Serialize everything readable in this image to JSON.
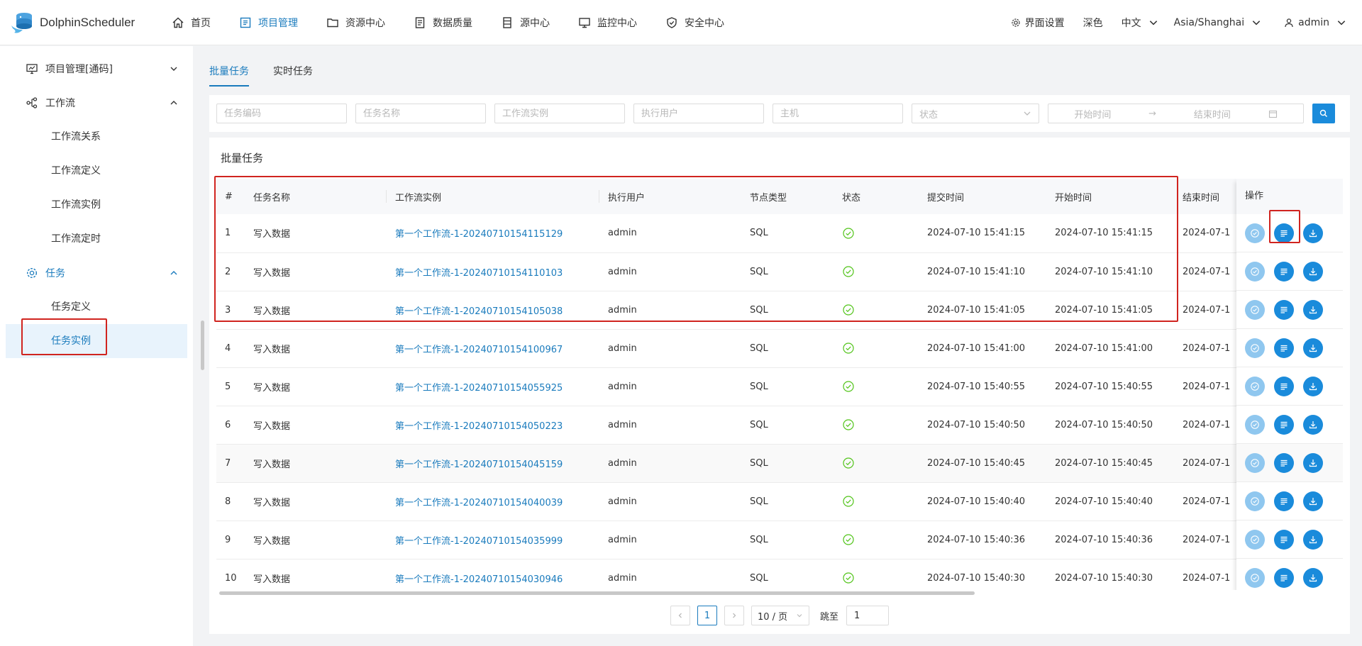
{
  "header": {
    "logo_text": "DolphinScheduler",
    "nav": [
      {
        "label": "首页",
        "icon": "home-icon"
      },
      {
        "label": "项目管理",
        "icon": "project-icon",
        "active": true
      },
      {
        "label": "资源中心",
        "icon": "folder-icon"
      },
      {
        "label": "数据质量",
        "icon": "data-quality-icon"
      },
      {
        "label": "源中心",
        "icon": "datasource-icon"
      },
      {
        "label": "监控中心",
        "icon": "monitor-icon"
      },
      {
        "label": "安全中心",
        "icon": "security-icon"
      }
    ],
    "settings_label": "界面设置",
    "theme_label": "深色",
    "language_label": "中文",
    "timezone_label": "Asia/Shanghai",
    "user_label": "admin"
  },
  "sidebar": {
    "groups": [
      {
        "label": "项目管理[通码]"
      },
      {
        "label": "工作流",
        "items": [
          "工作流关系",
          "工作流定义",
          "工作流实例",
          "工作流定时"
        ]
      },
      {
        "label": "任务",
        "items": [
          "任务定义",
          "任务实例"
        ]
      }
    ]
  },
  "tabs": [
    "批量任务",
    "实时任务"
  ],
  "filter": {
    "task_code_placeholder": "任务编码",
    "task_name_placeholder": "任务名称",
    "workflow_instance_placeholder": "工作流实例",
    "exec_user_placeholder": "执行用户",
    "host_placeholder": "主机",
    "state_placeholder": "状态",
    "start_time_placeholder": "开始时间",
    "end_time_placeholder": "结束时间"
  },
  "card_title": "批量任务",
  "table": {
    "headers": [
      "#",
      "任务名称",
      "工作流实例",
      "执行用户",
      "节点类型",
      "状态",
      "提交时间",
      "开始时间",
      "结束时间"
    ],
    "ops_header": "操作",
    "rows": [
      {
        "idx": "1",
        "name": "写入数据",
        "instance": "第一个工作流-1-20240710154115129",
        "user": "admin",
        "type": "SQL",
        "submit": "2024-07-10 15:41:15",
        "start": "2024-07-10 15:41:15",
        "end": "2024-07-1"
      },
      {
        "idx": "2",
        "name": "写入数据",
        "instance": "第一个工作流-1-20240710154110103",
        "user": "admin",
        "type": "SQL",
        "submit": "2024-07-10 15:41:10",
        "start": "2024-07-10 15:41:10",
        "end": "2024-07-1"
      },
      {
        "idx": "3",
        "name": "写入数据",
        "instance": "第一个工作流-1-20240710154105038",
        "user": "admin",
        "type": "SQL",
        "submit": "2024-07-10 15:41:05",
        "start": "2024-07-10 15:41:05",
        "end": "2024-07-1"
      },
      {
        "idx": "4",
        "name": "写入数据",
        "instance": "第一个工作流-1-20240710154100967",
        "user": "admin",
        "type": "SQL",
        "submit": "2024-07-10 15:41:00",
        "start": "2024-07-10 15:41:00",
        "end": "2024-07-1"
      },
      {
        "idx": "5",
        "name": "写入数据",
        "instance": "第一个工作流-1-20240710154055925",
        "user": "admin",
        "type": "SQL",
        "submit": "2024-07-10 15:40:55",
        "start": "2024-07-10 15:40:55",
        "end": "2024-07-1"
      },
      {
        "idx": "6",
        "name": "写入数据",
        "instance": "第一个工作流-1-20240710154050223",
        "user": "admin",
        "type": "SQL",
        "submit": "2024-07-10 15:40:50",
        "start": "2024-07-10 15:40:50",
        "end": "2024-07-1"
      },
      {
        "idx": "7",
        "name": "写入数据",
        "instance": "第一个工作流-1-20240710154045159",
        "user": "admin",
        "type": "SQL",
        "submit": "2024-07-10 15:40:45",
        "start": "2024-07-10 15:40:45",
        "end": "2024-07-1"
      },
      {
        "idx": "8",
        "name": "写入数据",
        "instance": "第一个工作流-1-20240710154040039",
        "user": "admin",
        "type": "SQL",
        "submit": "2024-07-10 15:40:40",
        "start": "2024-07-10 15:40:40",
        "end": "2024-07-1"
      },
      {
        "idx": "9",
        "name": "写入数据",
        "instance": "第一个工作流-1-20240710154035999",
        "user": "admin",
        "type": "SQL",
        "submit": "2024-07-10 15:40:36",
        "start": "2024-07-10 15:40:36",
        "end": "2024-07-1"
      },
      {
        "idx": "10",
        "name": "写入数据",
        "instance": "第一个工作流-1-20240710154030946",
        "user": "admin",
        "type": "SQL",
        "submit": "2024-07-10 15:40:30",
        "start": "2024-07-10 15:40:30",
        "end": "2024-07-1"
      }
    ]
  },
  "pager": {
    "current_page": "1",
    "page_size_label": "10 / 页",
    "jump_label": "跳至",
    "jump_value": "1"
  },
  "colors": {
    "accent": "#1a7bbd",
    "button": "#1a8bdb",
    "success": "#52c41a",
    "annotation": "#d0241f"
  }
}
